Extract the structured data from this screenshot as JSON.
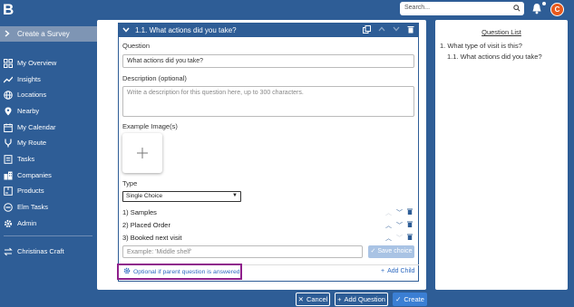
{
  "app": {
    "logo": "B"
  },
  "topbar": {
    "search_placeholder": "Search...",
    "avatar_initial": "C"
  },
  "sidebar": {
    "create_label": "Create a Survey",
    "items": [
      {
        "label": "My Overview",
        "icon": "grid-icon"
      },
      {
        "label": "Insights",
        "icon": "trend-icon"
      },
      {
        "label": "Locations",
        "icon": "globe-icon"
      },
      {
        "label": "Nearby",
        "icon": "pin-icon"
      },
      {
        "label": "My Calendar",
        "icon": "calendar-icon"
      },
      {
        "label": "My Route",
        "icon": "route-icon"
      },
      {
        "label": "Tasks",
        "icon": "tasks-icon"
      },
      {
        "label": "Companies",
        "icon": "building-icon"
      },
      {
        "label": "Products",
        "icon": "box-icon"
      },
      {
        "label": "Elm Tasks",
        "icon": "minus-circle-icon"
      },
      {
        "label": "Admin",
        "icon": "gear-icon"
      }
    ],
    "workspace": "Christinas Craft"
  },
  "question": {
    "header": "1.1. What actions did you take?",
    "question_label": "Question",
    "question_value": "What actions did you take?",
    "description_label": "Description (optional)",
    "description_placeholder": "Write a description for this question here, up to 300 characters.",
    "images_label": "Example Image(s)",
    "type_label": "Type",
    "type_value": "Single Choice",
    "options": [
      "1) Samples",
      "2) Placed Order",
      "3) Booked next visit"
    ],
    "new_option_placeholder": "Example: 'Middle shelf'",
    "save_choice_label": "Save choice",
    "optional_label": "Optional if parent question is answered",
    "add_child_label": "Add Child"
  },
  "question_list": {
    "title": "Question List",
    "items": [
      "1. What type of visit is this?",
      "1.1. What actions did you take?"
    ]
  },
  "footer": {
    "cancel": "Cancel",
    "add_question": "Add Question",
    "create": "Create"
  },
  "colors": {
    "brand": "#2e5d96",
    "accent": "#3b7fd4",
    "highlight": "#8e1f8b",
    "avatar": "#e8591c"
  }
}
